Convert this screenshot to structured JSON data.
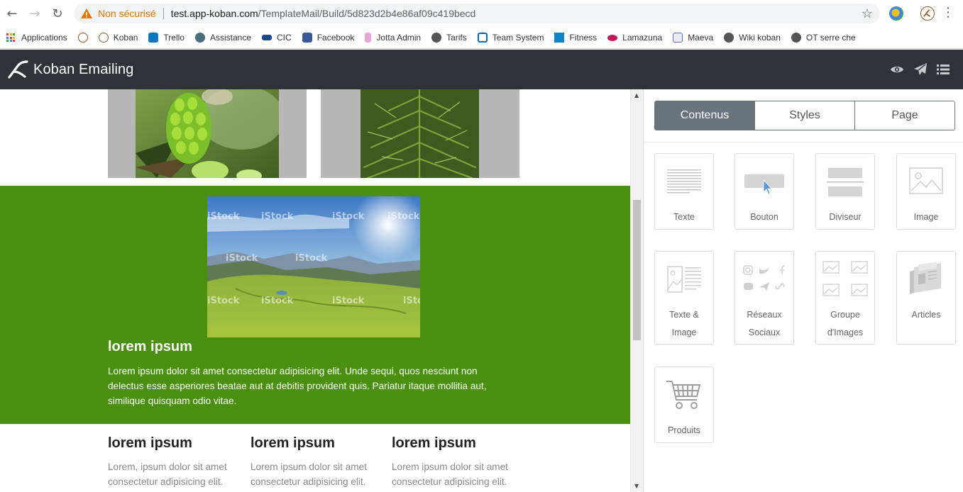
{
  "browser": {
    "insecure_label": "Non sécurisé",
    "url_host": "test.app-koban.com",
    "url_path": "/TemplateMail/Build/5d823d2b4e86af09c419becd",
    "bookmarks": [
      {
        "label": "Applications",
        "icon": "apps-grid-icon",
        "color": "#4285f4"
      },
      {
        "label": "",
        "icon": "koban-icon",
        "color": "#8b5a2b"
      },
      {
        "label": "Koban",
        "icon": "koban-icon",
        "color": "#8b5a2b"
      },
      {
        "label": "Trello",
        "icon": "trello-icon",
        "color": "#0079bf"
      },
      {
        "label": "Assistance",
        "icon": "assistance-icon",
        "color": "#4a6e7a"
      },
      {
        "label": "CIC",
        "icon": "cic-icon",
        "color": "#1a4a8a"
      },
      {
        "label": "Facebook",
        "icon": "facebook-icon",
        "color": "#3b5998"
      },
      {
        "label": "Jotta Admin",
        "icon": "jotta-icon",
        "color": "#e8a6d8"
      },
      {
        "label": "Tarifs",
        "icon": "globe-icon",
        "color": "#555555"
      },
      {
        "label": "Team System",
        "icon": "team-system-icon",
        "color": "#0067b8"
      },
      {
        "label": "Fitness",
        "icon": "fitness-icon",
        "color": "#0a84c9"
      },
      {
        "label": "Lamazuna",
        "icon": "lamazuna-icon",
        "color": "#c2185b"
      },
      {
        "label": "Maeva",
        "icon": "maeva-icon",
        "color": "#5c6bc0"
      },
      {
        "label": "Wiki koban",
        "icon": "globe-icon",
        "color": "#555555"
      },
      {
        "label": "OT serre che",
        "icon": "globe-icon",
        "color": "#555555"
      }
    ]
  },
  "app": {
    "title": "Koban Emailing",
    "header_icons": [
      "eye-icon",
      "send-icon",
      "list-icon"
    ]
  },
  "canvas": {
    "band_color": "#4a8f0e",
    "band_title": "lorem ipsum",
    "band_text": "Lorem ipsum dolor sit amet consectetur adipisicing elit. Unde sequi, quos nesciunt non delectus esse asperiores beatae aut at debitis provident quis. Pariatur itaque mollitia aut, similique quisquam odio vitae.",
    "watermark": "iStock",
    "columns": [
      {
        "title": "lorem ipsum",
        "text": "Lorem, ipsum dolor sit amet consectetur adipisicing elit."
      },
      {
        "title": "lorem ipsum",
        "text": "Lorem ipsum dolor sit amet consectetur adipisicing elit."
      },
      {
        "title": "lorem ipsum",
        "text": "Lorem ipsum dolor sit amet consectetur adipisicing elit."
      }
    ]
  },
  "panel": {
    "tabs": [
      {
        "label": "Contenus",
        "active": true
      },
      {
        "label": "Styles",
        "active": false
      },
      {
        "label": "Page",
        "active": false
      }
    ],
    "blocks": [
      {
        "label": "Texte",
        "icon": "text-block-icon"
      },
      {
        "label": "Bouton",
        "icon": "button-block-icon"
      },
      {
        "label": "Diviseur",
        "icon": "divider-block-icon"
      },
      {
        "label": "Image",
        "icon": "image-block-icon"
      },
      {
        "label": "Texte &",
        "label2": "Image",
        "icon": "text-image-block-icon"
      },
      {
        "label": "Réseaux",
        "label2": "Sociaux",
        "icon": "social-block-icon"
      },
      {
        "label": "Groupe",
        "label2": "d'Images",
        "icon": "image-group-block-icon"
      },
      {
        "label": "Articles",
        "icon": "articles-block-icon"
      },
      {
        "label": "Produits",
        "icon": "products-block-icon"
      }
    ]
  }
}
